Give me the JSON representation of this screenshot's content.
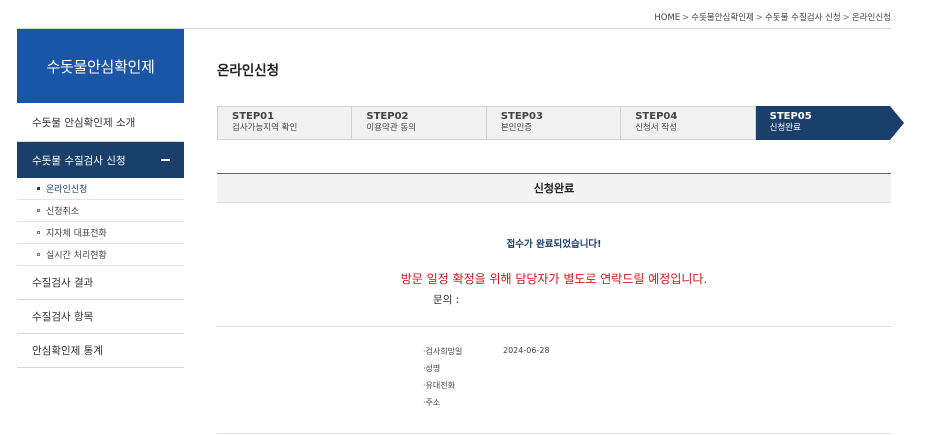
{
  "breadcrumb": [
    "HOME",
    "수돗물안심확인제",
    "수돗물 수질검사 신청",
    "온라인신청"
  ],
  "breadcrumb_sep": ">",
  "sidebar": {
    "title": "수돗물안심확인제",
    "items": [
      {
        "label": "수돗물 안심확인제 소개"
      },
      {
        "label": "수돗물 수질검사 신청",
        "active": true,
        "children": [
          "온라인신청",
          "신청취소",
          "지자체 대표전화",
          "실시간 처리현황"
        ]
      },
      {
        "label": "수질검사 결과"
      },
      {
        "label": "수질검사 항목"
      },
      {
        "label": "안심확인제 통계"
      }
    ]
  },
  "page_title": "온라인신청",
  "steps": [
    {
      "num": "STEP01",
      "label": "검사가능지역 확인"
    },
    {
      "num": "STEP02",
      "label": "이용약관 동의"
    },
    {
      "num": "STEP03",
      "label": "본인인증"
    },
    {
      "num": "STEP04",
      "label": "신청서 작성"
    },
    {
      "num": "STEP05",
      "label": "신청완료",
      "active": true
    }
  ],
  "result": {
    "heading": "신청완료",
    "done_message": "접수가 완료되었습니다!",
    "notice": "방문 일정 확정을 위해 담당자가 별도로 연락드릴 예정입니다.",
    "contact": "문의 :"
  },
  "info": [
    {
      "key": "·검사희망일",
      "value": "2024-06-28"
    },
    {
      "key": "·성명",
      "value": ""
    },
    {
      "key": "·유대전화",
      "value": ""
    },
    {
      "key": "·주소",
      "value": ""
    }
  ],
  "colors": {
    "primary": "#1a56a8",
    "navy": "#1a3f6a",
    "alert": "#d4151c"
  }
}
